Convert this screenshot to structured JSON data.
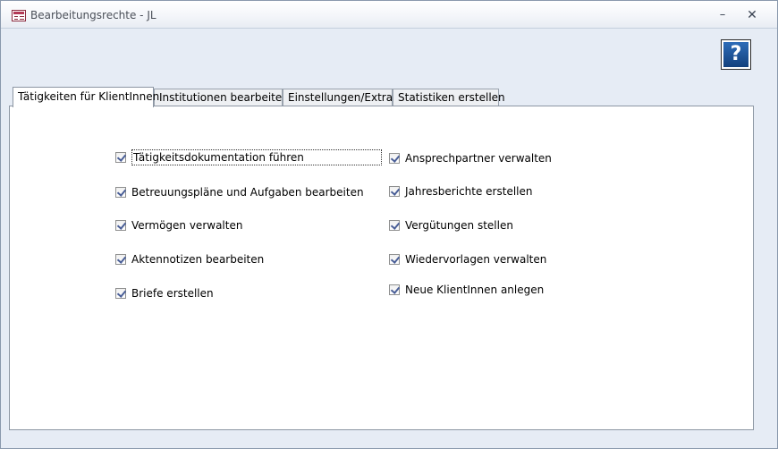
{
  "window": {
    "title": "Bearbeitungsrechte - JL",
    "minimize_glyph": "–",
    "close_glyph": "✕"
  },
  "help_button": {
    "glyph": "?",
    "icon": "help-icon"
  },
  "tabs": [
    {
      "label": "Tätigkeiten für KlientInnen",
      "active": true
    },
    {
      "label": "Institutionen bearbeiten",
      "active": false
    },
    {
      "label": "Einstellungen/Extras",
      "active": false
    },
    {
      "label": "Statistiken erstellen",
      "active": false
    }
  ],
  "permissions": {
    "left": [
      {
        "label": "Tätigkeitsdokumentation führen",
        "checked": true
      },
      {
        "label": "Betreuungspläne und Aufgaben bearbeiten",
        "checked": true
      },
      {
        "label": "Vermögen verwalten",
        "checked": true
      },
      {
        "label": "Aktennotizen bearbeiten",
        "checked": true
      },
      {
        "label": "Briefe erstellen",
        "checked": true
      }
    ],
    "right": [
      {
        "label": "Ansprechpartner verwalten",
        "checked": true
      },
      {
        "label": "Jahresberichte erstellen",
        "checked": true
      },
      {
        "label": "Vergütungen stellen",
        "checked": true
      },
      {
        "label": "Wiedervorlagen verwalten",
        "checked": true
      },
      {
        "label": "Neue KlientInnen anlegen",
        "checked": true
      }
    ]
  }
}
